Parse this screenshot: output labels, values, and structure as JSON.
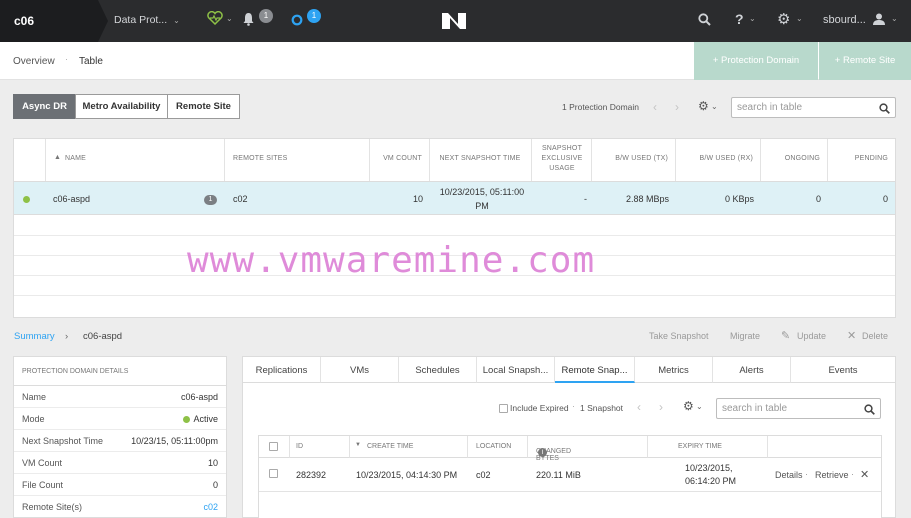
{
  "topbar": {
    "cluster": "c06",
    "section": "Data Prot...",
    "alerts_count": "1",
    "tasks_count": "1",
    "help": "?",
    "user": "sbourd...",
    "logo": "N"
  },
  "subnav": {
    "tabs": [
      "Overview",
      "Table"
    ],
    "active_tab": "Table",
    "buttons": [
      "+  Protection Domain",
      "+  Remote Site"
    ]
  },
  "filters": {
    "segments": [
      "Async DR",
      "Metro Availability",
      "Remote Site"
    ],
    "active": "Async DR",
    "pd_count": "1 Protection Domain",
    "search_placeholder": "search in table"
  },
  "main_table": {
    "headers": [
      "NAME",
      "REMOTE SITES",
      "VM COUNT",
      "NEXT SNAPSHOT TIME",
      "SNAPSHOT EXCLUSIVE USAGE",
      "B/W USED (TX)",
      "B/W USED (RX)",
      "ONGOING",
      "PENDING"
    ],
    "row": {
      "name": "c06-aspd",
      "badge": "1",
      "remote_sites": "c02",
      "vm_count": "10",
      "next_snapshot": "10/23/2015, 05:11:00 PM",
      "exclusive_usage": "-",
      "bw_tx": "2.88 MBps",
      "bw_rx": "0 KBps",
      "ongoing": "0",
      "pending": "0"
    }
  },
  "watermark": "www.vmwaremine.com",
  "summary": {
    "link": "Summary",
    "separator": "›",
    "current": "c06-aspd",
    "actions": [
      "Take Snapshot",
      "Migrate",
      "Update",
      "Delete"
    ]
  },
  "details": {
    "header": "PROTECTION DOMAIN DETAILS",
    "rows": [
      {
        "k": "Name",
        "v": "c06-aspd"
      },
      {
        "k": "Mode",
        "v": "Active"
      },
      {
        "k": "Next Snapshot Time",
        "v": "10/23/15, 05:11:00pm"
      },
      {
        "k": "VM Count",
        "v": "10"
      },
      {
        "k": "File Count",
        "v": "0"
      },
      {
        "k": "Remote Site(s)",
        "v": "c02"
      }
    ]
  },
  "rpanel": {
    "tabs": [
      "Replications",
      "VMs",
      "Schedules",
      "Local Snapsh...",
      "Remote Snap...",
      "Metrics",
      "Alerts",
      "Events"
    ],
    "active_tab": "Remote Snap...",
    "include_expired": "Include Expired",
    "snapshot_count": "1 Snapshot",
    "search_placeholder": "search in table",
    "headers": [
      "ID",
      "CREATE TIME",
      "LOCATION",
      "CHANGED BYTES",
      "EXPIRY TIME"
    ],
    "row": {
      "id": "282392",
      "create_time": "10/23/2015, 04:14:30 PM",
      "location": "c02",
      "changed_bytes": "220.11 MiB",
      "expiry": "10/23/2015, 06:14:20 PM",
      "details": "Details",
      "retrieve": "Retrieve",
      "sep": "·"
    }
  }
}
